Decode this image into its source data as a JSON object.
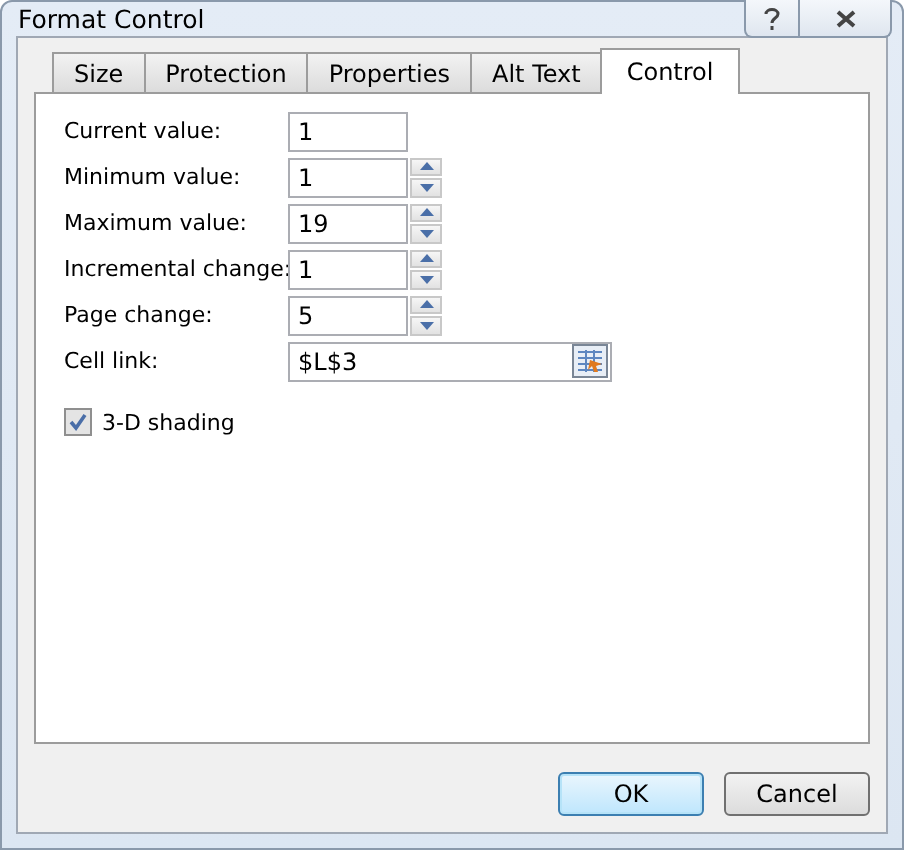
{
  "window": {
    "title": "Format Control"
  },
  "tabs": [
    {
      "label": "Size",
      "selected": false
    },
    {
      "label": "Protection",
      "selected": false
    },
    {
      "label": "Properties",
      "selected": false
    },
    {
      "label": "Alt Text",
      "selected": false
    },
    {
      "label": "Control",
      "selected": true
    }
  ],
  "fields": [
    {
      "kind": "text",
      "label": "Current value:",
      "value": "1"
    },
    {
      "kind": "spin",
      "label": "Minimum value:",
      "value": "1"
    },
    {
      "kind": "spin",
      "label": "Maximum value:",
      "value": "19"
    },
    {
      "kind": "spin",
      "label": "Incremental change:",
      "value": "1"
    },
    {
      "kind": "spin",
      "label": "Page change:",
      "value": "5"
    },
    {
      "kind": "reference",
      "label": "Cell link:",
      "value": "$L$3"
    }
  ],
  "checkbox": {
    "label": "3-D shading",
    "checked": true
  },
  "buttons": [
    {
      "label": "OK",
      "default": true
    },
    {
      "label": "Cancel",
      "default": false
    }
  ]
}
